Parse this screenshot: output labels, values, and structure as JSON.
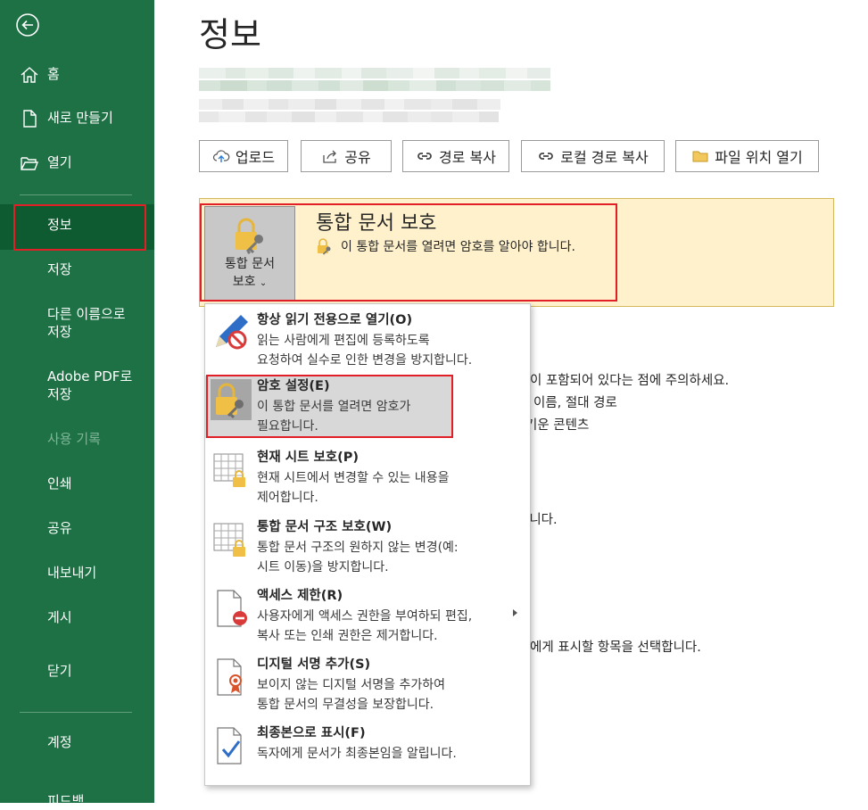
{
  "sidebar": {
    "items": [
      {
        "label": "홈",
        "icon": "home-icon"
      },
      {
        "label": "새로 만들기",
        "icon": "new-document-icon"
      },
      {
        "label": "열기",
        "icon": "open-folder-icon"
      },
      {
        "label": "정보",
        "active": true
      },
      {
        "label": "저장"
      },
      {
        "label": "다른 이름으로\n저장"
      },
      {
        "label": "Adobe PDF로\n저장"
      },
      {
        "label": "사용 기록",
        "disabled": true
      },
      {
        "label": "인쇄"
      },
      {
        "label": "공유"
      },
      {
        "label": "내보내기"
      },
      {
        "label": "게시"
      },
      {
        "label": "닫기"
      },
      {
        "label": "계정"
      },
      {
        "label": "피드백"
      }
    ]
  },
  "main": {
    "title": "정보",
    "toolbar": [
      {
        "label": "업로드",
        "icon": "upload-cloud-icon"
      },
      {
        "label": "공유",
        "icon": "share-icon"
      },
      {
        "label": "경로 복사",
        "icon": "link-icon"
      },
      {
        "label": "로컬 경로 복사",
        "icon": "link-icon"
      },
      {
        "label": "파일 위치 열기",
        "icon": "folder-icon"
      }
    ],
    "protect": {
      "button_line1": "통합 문서",
      "button_line2": "보호",
      "heading": "통합 문서 보호",
      "description": "이 통합 문서를 열려면 암호를 알아야 합니다."
    },
    "background_text": [
      "이 포함되어 있다는 점에 주의하세요.",
      "이름, 절대 경로",
      "기운 콘텐츠",
      "습니다.",
      "에게 표시할 항목을 선택합니다."
    ]
  },
  "dropdown": {
    "items": [
      {
        "title": "항상 읽기 전용으로 열기(O)",
        "desc": [
          "읽는 사람에게 편집에 등록하도록",
          "요청하여 실수로 인한 변경을 방지합니다."
        ],
        "icon": "pencil-no-icon"
      },
      {
        "title": "암호 설정(E)",
        "desc": [
          "이 통합 문서를 열려면 암호가",
          "필요합니다."
        ],
        "icon": "lock-key-icon",
        "highlighted": true
      },
      {
        "title": "현재 시트 보호(P)",
        "desc": [
          "현재 시트에서 변경할 수 있는 내용을",
          "제어합니다."
        ],
        "icon": "sheet-lock-icon"
      },
      {
        "title": "통합 문서 구조 보호(W)",
        "desc": [
          "통합 문서 구조의 원하지 않는 변경(예:",
          "시트 이동)을 방지합니다."
        ],
        "icon": "workbook-lock-icon"
      },
      {
        "title": "액세스 제한(R)",
        "desc": [
          "사용자에게 액세스 권한을 부여하되 편집,",
          "복사 또는 인쇄 권한은 제거합니다."
        ],
        "icon": "doc-restrict-icon"
      },
      {
        "title": "디지털 서명 추가(S)",
        "desc": [
          "보이지 않는 디지털 서명을 추가하여",
          "통합 문서의 무결성을 보장합니다."
        ],
        "icon": "doc-ribbon-icon"
      },
      {
        "title": "최종본으로 표시(F)",
        "desc": [
          "독자에게 문서가 최종본임을 알립니다."
        ],
        "icon": "doc-check-icon"
      }
    ]
  },
  "colors": {
    "sidebar": "#1e7145",
    "sidebar_active": "#0e5a31",
    "highlight_outline": "#e21f26",
    "protect_band": "#fff1cc"
  }
}
